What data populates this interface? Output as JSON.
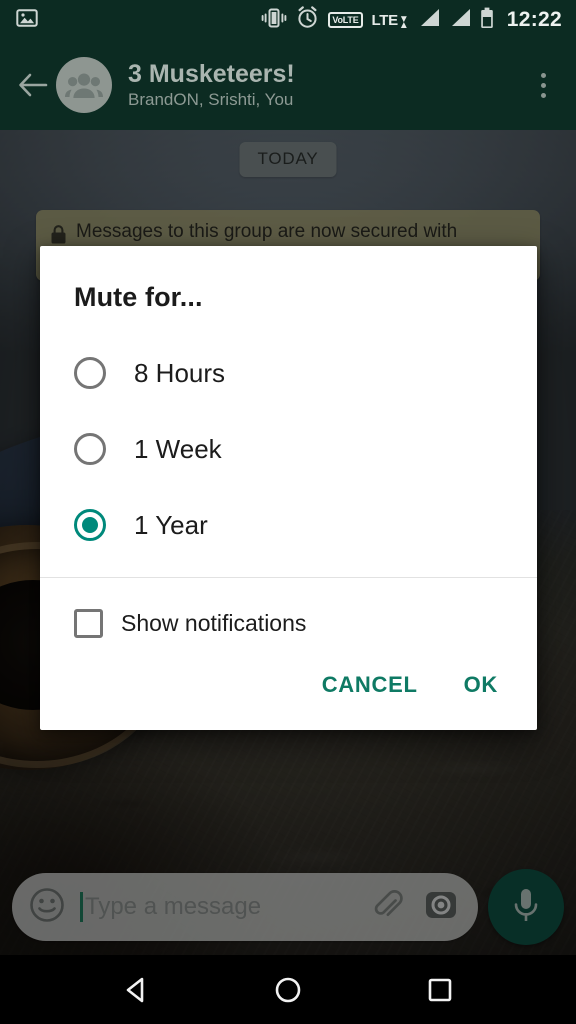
{
  "status_bar": {
    "time": "12:22",
    "icons": [
      "photo-icon",
      "vibrate-icon",
      "alarm-icon",
      "volte-icon",
      "lte-icon",
      "signal-bars-1-icon",
      "signal-bars-2-icon",
      "battery-icon"
    ],
    "volte_label": "VoLTE",
    "lte_label": "LTE"
  },
  "app_bar": {
    "back_icon": "back-arrow-icon",
    "avatar_icon": "group-avatar-icon",
    "title": "3 Musketeers!",
    "subtitle": "BrandON, Srishti, You",
    "overflow_icon": "more-vertical-icon",
    "background_color": "#0c2b22"
  },
  "chat": {
    "date_chip": "TODAY",
    "encryption_notice": "Messages to this group are now secured with",
    "lock_icon": "lock-icon"
  },
  "composer": {
    "emoji_icon": "emoji-smiley-icon",
    "placeholder": "Type a message",
    "value": "",
    "attach_icon": "paperclip-icon",
    "camera_icon": "camera-icon",
    "mic_icon": "microphone-icon",
    "mic_color": "#0e5244"
  },
  "dialog": {
    "title": "Mute for...",
    "accent_color": "#00897B",
    "options": [
      {
        "label": "8 Hours",
        "selected": false
      },
      {
        "label": "1 Week",
        "selected": false
      },
      {
        "label": "1 Year",
        "selected": true
      }
    ],
    "checkbox": {
      "label": "Show notifications",
      "checked": false
    },
    "buttons": {
      "cancel": "CANCEL",
      "ok": "OK"
    }
  },
  "nav_bar": {
    "back": "nav-back-icon",
    "home": "nav-home-icon",
    "recents": "nav-recents-icon"
  }
}
